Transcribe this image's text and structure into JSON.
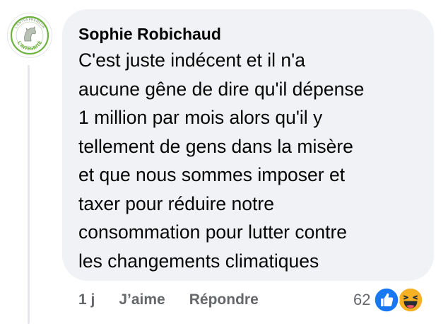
{
  "comment": {
    "author": "Sophie Robichaud",
    "avatar": {
      "ring_text_top": "L'ENTREPRENEUR",
      "ring_text_bottom": "L'INTÉGRITÉ",
      "brand_color": "#6cb33f"
    },
    "text_lines": [
      "C'est juste indécent et il n'a",
      "aucune gêne de dire qu'il dépense",
      "1 million par mois alors qu'il y",
      "tellement de gens dans la misère",
      "et que nous sommes imposer et",
      "taxer pour réduire notre",
      "consommation pour lutter contre",
      "les changements climatiques"
    ]
  },
  "actions": {
    "time": "1 j",
    "like_label": "J’aime",
    "reply_label": "Répondre"
  },
  "reactions": {
    "count": "62",
    "types": [
      "like-reaction-icon",
      "haha-reaction-icon"
    ],
    "like_color": "#1877f2",
    "haha_color": "#f7b125"
  },
  "colors": {
    "bubble_bg": "#f0f2f5",
    "primary_text": "#050505",
    "secondary_text": "#65676b"
  }
}
